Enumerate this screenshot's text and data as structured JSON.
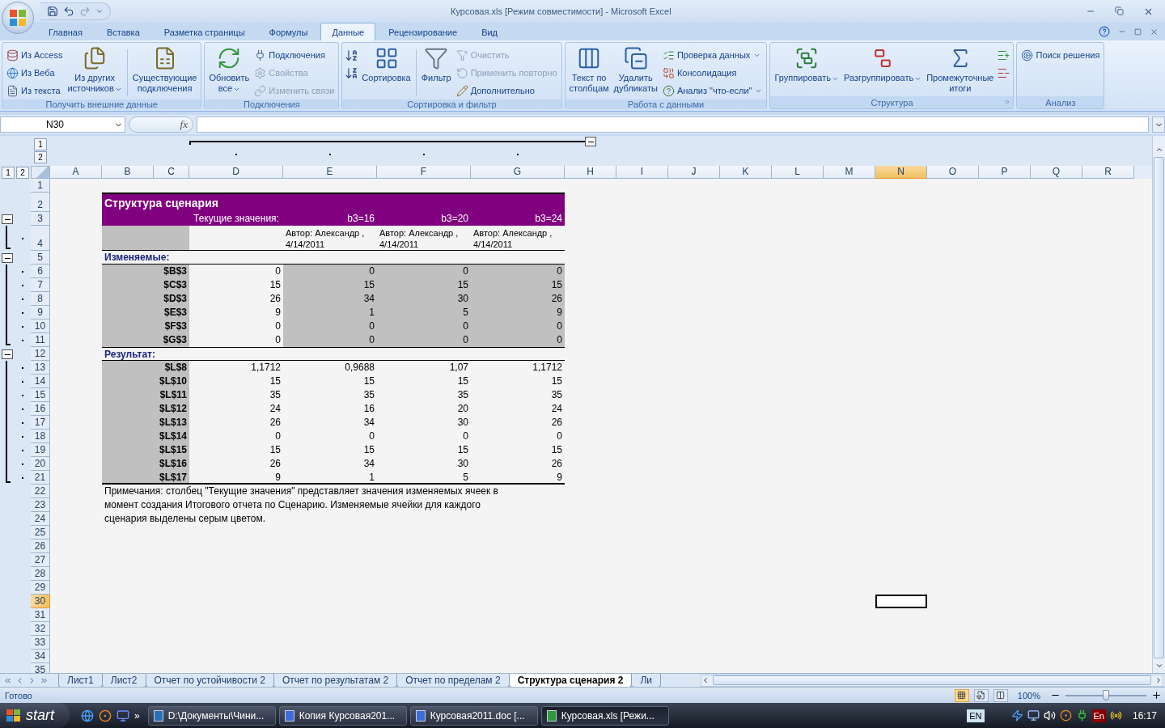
{
  "window": {
    "title": "Курсовая.xls  [Режим совместимости] - Microsoft Excel"
  },
  "ribbon": {
    "tabs": [
      {
        "label": "Главная",
        "selected": false
      },
      {
        "label": "Вставка",
        "selected": false
      },
      {
        "label": "Разметка страницы",
        "selected": false
      },
      {
        "label": "Формулы",
        "selected": false
      },
      {
        "label": "Данные",
        "selected": true
      },
      {
        "label": "Рецензирование",
        "selected": false
      },
      {
        "label": "Вид",
        "selected": false
      }
    ],
    "groups": [
      {
        "label": "Получить внешние данные",
        "launcher": false,
        "columns": [
          {
            "kind": "stack",
            "items": [
              {
                "label": "Из Access",
                "disabled": false,
                "dropdown": false
              },
              {
                "label": "Из Веба",
                "disabled": false,
                "dropdown": false
              },
              {
                "label": "Из текста",
                "disabled": false,
                "dropdown": false
              }
            ]
          },
          {
            "kind": "large",
            "label": "Из других\nисточников",
            "dropdown": true,
            "disabled": false
          },
          {
            "kind": "separator"
          },
          {
            "kind": "large",
            "label": "Существующие\nподключения",
            "dropdown": false,
            "disabled": false
          }
        ]
      },
      {
        "label": "Подключения",
        "launcher": false,
        "columns": [
          {
            "kind": "large",
            "label": "Обновить\nвсе",
            "dropdown": true,
            "disabled": false
          },
          {
            "kind": "stack",
            "items": [
              {
                "label": "Подключения",
                "disabled": false,
                "dropdown": false
              },
              {
                "label": "Свойства",
                "disabled": true,
                "dropdown": false
              },
              {
                "label": "Изменить связи",
                "disabled": true,
                "dropdown": false
              }
            ]
          }
        ]
      },
      {
        "label": "Сортировка и фильтр",
        "launcher": false,
        "columns": [
          {
            "kind": "icons",
            "items": [
              {
                "disabled": false
              },
              {
                "disabled": false
              }
            ]
          },
          {
            "kind": "large",
            "label": "Сортировка",
            "dropdown": false,
            "disabled": false
          },
          {
            "kind": "separator"
          },
          {
            "kind": "large",
            "label": "Фильтр",
            "dropdown": false,
            "disabled": false
          },
          {
            "kind": "stack",
            "items": [
              {
                "label": "Очистить",
                "disabled": true,
                "dropdown": false
              },
              {
                "label": "Применить повторно",
                "disabled": true,
                "dropdown": false
              },
              {
                "label": "Дополнительно",
                "disabled": false,
                "dropdown": false
              }
            ]
          }
        ]
      },
      {
        "label": "Работа с данными",
        "launcher": false,
        "columns": [
          {
            "kind": "large",
            "label": "Текст по\nстолбцам",
            "dropdown": false,
            "disabled": false
          },
          {
            "kind": "large",
            "label": "Удалить\nдубликаты",
            "dropdown": false,
            "disabled": false
          },
          {
            "kind": "stack",
            "items": [
              {
                "label": "Проверка данных",
                "disabled": false,
                "dropdown": true
              },
              {
                "label": "Консолидация",
                "disabled": false,
                "dropdown": false
              },
              {
                "label": "Анализ \"что-если\"",
                "disabled": false,
                "dropdown": true
              }
            ]
          }
        ]
      },
      {
        "label": "Структура",
        "launcher": true,
        "columns": [
          {
            "kind": "large",
            "label": "Группировать",
            "dropdown": true,
            "disabled": false
          },
          {
            "kind": "large",
            "label": "Разгруппировать",
            "dropdown": true,
            "disabled": false
          },
          {
            "kind": "large",
            "label": "Промежуточные\nитоги",
            "dropdown": false,
            "disabled": false
          },
          {
            "kind": "icons",
            "items": [
              {
                "disabled": false
              },
              {
                "disabled": false
              }
            ]
          }
        ]
      },
      {
        "label": "Анализ",
        "launcher": false,
        "columns": [
          {
            "kind": "stack",
            "items": [
              {
                "label": "Поиск решения",
                "disabled": false,
                "dropdown": false
              }
            ]
          }
        ]
      }
    ]
  },
  "formula_bar": {
    "name_box": "N30",
    "fx_label": "fx"
  },
  "outline": {
    "column_levels": [
      "1",
      "2"
    ],
    "row_levels": [
      "1",
      "2"
    ]
  },
  "columns": [
    {
      "label": "A",
      "selected": false
    },
    {
      "label": "B",
      "selected": false
    },
    {
      "label": "C",
      "selected": false
    },
    {
      "label": "D",
      "selected": false
    },
    {
      "label": "E",
      "selected": false
    },
    {
      "label": "F",
      "selected": false
    },
    {
      "label": "G",
      "selected": false
    },
    {
      "label": "H",
      "selected": false
    },
    {
      "label": "I",
      "selected": false
    },
    {
      "label": "J",
      "selected": false
    },
    {
      "label": "K",
      "selected": false
    },
    {
      "label": "L",
      "selected": false
    },
    {
      "label": "M",
      "selected": false
    },
    {
      "label": "N",
      "selected": true
    },
    {
      "label": "O",
      "selected": false
    },
    {
      "label": "P",
      "selected": false
    },
    {
      "label": "Q",
      "selected": false
    },
    {
      "label": "R",
      "selected": false
    }
  ],
  "rows": [
    {
      "label": "1",
      "selected": false
    },
    {
      "label": "2",
      "selected": false
    },
    {
      "label": "3",
      "selected": false
    },
    {
      "label": "4",
      "selected": false
    },
    {
      "label": "5",
      "selected": false
    },
    {
      "label": "6",
      "selected": false
    },
    {
      "label": "7",
      "selected": false
    },
    {
      "label": "8",
      "selected": false
    },
    {
      "label": "9",
      "selected": false
    },
    {
      "label": "10",
      "selected": false
    },
    {
      "label": "11",
      "selected": false
    },
    {
      "label": "12",
      "selected": false
    },
    {
      "label": "13",
      "selected": false
    },
    {
      "label": "14",
      "selected": false
    },
    {
      "label": "15",
      "selected": false
    },
    {
      "label": "16",
      "selected": false
    },
    {
      "label": "17",
      "selected": false
    },
    {
      "label": "18",
      "selected": false
    },
    {
      "label": "19",
      "selected": false
    },
    {
      "label": "20",
      "selected": false
    },
    {
      "label": "21",
      "selected": false
    },
    {
      "label": "22",
      "selected": false
    },
    {
      "label": "23",
      "selected": false
    },
    {
      "label": "24",
      "selected": false
    },
    {
      "label": "25",
      "selected": false
    },
    {
      "label": "26",
      "selected": false
    },
    {
      "label": "27",
      "selected": false
    },
    {
      "label": "28",
      "selected": false
    },
    {
      "label": "29",
      "selected": false
    },
    {
      "label": "30",
      "selected": true
    },
    {
      "label": "31",
      "selected": false
    },
    {
      "label": "32",
      "selected": false
    },
    {
      "label": "33",
      "selected": false
    },
    {
      "label": "34",
      "selected": false
    },
    {
      "label": "35",
      "selected": false
    }
  ],
  "report": {
    "title": "Структура сценария",
    "current_label": "Текущие значения:",
    "scenarios": [
      {
        "name": "b3=16",
        "author": "Автор: Александр , 4/14/2011"
      },
      {
        "name": "b3=20",
        "author": "Автор: Александр , 4/14/2011"
      },
      {
        "name": "b3=24",
        "author": "Автор: Александр , 4/14/2011"
      }
    ],
    "changing_label": "Изменяемые:",
    "changing_rows": [
      {
        "cell": "$B$3",
        "values": [
          "0",
          "0",
          "0",
          "0"
        ]
      },
      {
        "cell": "$C$3",
        "values": [
          "15",
          "15",
          "15",
          "15"
        ]
      },
      {
        "cell": "$D$3",
        "values": [
          "26",
          "34",
          "30",
          "26"
        ]
      },
      {
        "cell": "$E$3",
        "values": [
          "9",
          "1",
          "5",
          "9"
        ]
      },
      {
        "cell": "$F$3",
        "values": [
          "0",
          "0",
          "0",
          "0"
        ]
      },
      {
        "cell": "$G$3",
        "values": [
          "0",
          "0",
          "0",
          "0"
        ]
      }
    ],
    "result_label": "Результат:",
    "result_rows": [
      {
        "cell": "$L$8",
        "values": [
          "1,1712",
          "0,9688",
          "1,07",
          "1,1712"
        ]
      },
      {
        "cell": "$L$10",
        "values": [
          "15",
          "15",
          "15",
          "15"
        ]
      },
      {
        "cell": "$L$11",
        "values": [
          "35",
          "35",
          "35",
          "35"
        ]
      },
      {
        "cell": "$L$12",
        "values": [
          "24",
          "16",
          "20",
          "24"
        ]
      },
      {
        "cell": "$L$13",
        "values": [
          "26",
          "34",
          "30",
          "26"
        ]
      },
      {
        "cell": "$L$14",
        "values": [
          "0",
          "0",
          "0",
          "0"
        ]
      },
      {
        "cell": "$L$15",
        "values": [
          "15",
          "15",
          "15",
          "15"
        ]
      },
      {
        "cell": "$L$16",
        "values": [
          "26",
          "34",
          "30",
          "26"
        ]
      },
      {
        "cell": "$L$17",
        "values": [
          "9",
          "1",
          "5",
          "9"
        ]
      }
    ],
    "note": "Примечания: столбец \"Текущие значения\" представляет значения изменяемых ячеек в момент создания Итогового отчета по Сценарию. Изменяемые ячейки для каждого сценария выделены серым цветом."
  },
  "sheet_tabs": [
    {
      "label": "Лист1",
      "selected": false
    },
    {
      "label": "Лист2",
      "selected": false
    },
    {
      "label": "Отчет по устойчивости 2",
      "selected": false
    },
    {
      "label": "Отчет по результатам 2",
      "selected": false
    },
    {
      "label": "Отчет по пределам 2",
      "selected": false
    },
    {
      "label": "Структура сценария 2",
      "selected": true
    },
    {
      "label": "Ли",
      "selected": false
    }
  ],
  "status_bar": {
    "status": "Готово",
    "views": [
      {
        "selected": true
      },
      {
        "selected": false
      },
      {
        "selected": false
      }
    ],
    "zoom": "100%",
    "zoom_slider": {
      "level": 0.5
    }
  },
  "taskbar": {
    "start": "start",
    "more": "»",
    "tasks": [
      {
        "label": "D:\\Документы\\Чини...",
        "selected": false
      },
      {
        "label": "Копия Курсовая201...",
        "selected": false
      },
      {
        "label": "Курсовая2011.doc [...",
        "selected": false
      },
      {
        "label": "Курсовая.xls  [Режи...",
        "selected": true
      }
    ],
    "language": "EN",
    "tray_language": "En",
    "clock": "16:17"
  }
}
